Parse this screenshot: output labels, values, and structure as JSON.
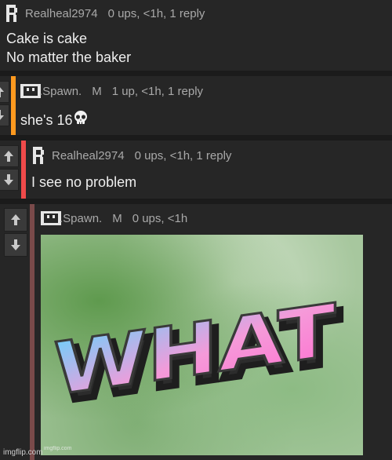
{
  "colors": {
    "comment_bg": "#262626",
    "page_bg": "#1b1b1b",
    "bar_level1": "#ff9a1f",
    "bar_level2": "#f04a4a",
    "bar_level3": "#7a4a4a",
    "text": "#eeeeee",
    "meta": "#a9a9a9"
  },
  "comments": [
    {
      "username": "Realheal2974",
      "stats": "0 ups, <1h, 1 reply",
      "lines": [
        "Cake is cake",
        "No matter the baker"
      ]
    },
    {
      "username": ".Spawn.",
      "badge": "M",
      "stats": "1 up, <1h, 1 reply",
      "text": "she's 16",
      "emoji": "skull-emoji"
    },
    {
      "username": "Realheal2974",
      "stats": "0 ups, <1h, 1 reply",
      "text": "I see no problem"
    },
    {
      "username": ".Spawn.",
      "badge": "M",
      "stats": "0 ups, <1h",
      "image_text": "WHAT",
      "image_watermark": "imgflip.com"
    }
  ],
  "watermark": "imgflip.com",
  "icons": {
    "upvote": "arrow-up-icon",
    "downvote": "arrow-down-icon",
    "avatar_realheal": "pixel-avatar-icon",
    "avatar_spawn": "pixel-avatar-icon"
  }
}
